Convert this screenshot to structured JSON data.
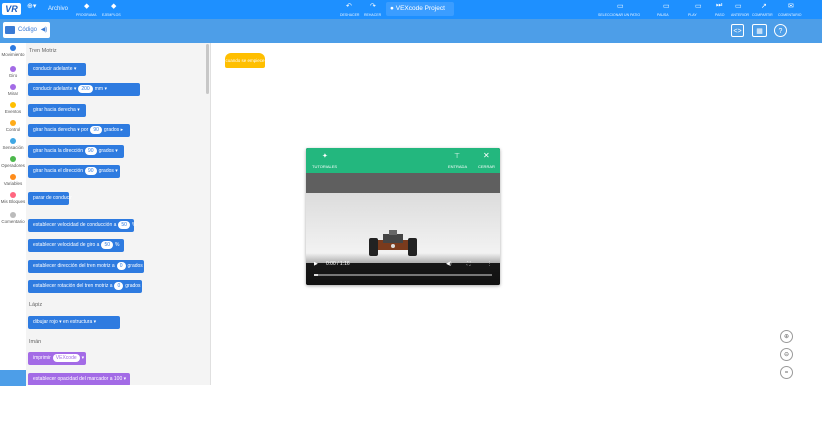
{
  "topbar": {
    "logo": "VR",
    "archive_label": "Archivo",
    "item_a": "PROGRAMA",
    "item_b": "EJEMPLOS",
    "undo_label": "DESHACER",
    "redo_label": "REHACER",
    "project_title": "VEXcode Project",
    "right_items": [
      "SELECCIONAR UN PATIO",
      "PAUSA",
      "PLAY",
      "PASO",
      "ANTERIOR",
      "COMPARTIR",
      "COMENTARIO"
    ]
  },
  "subbar": {
    "code_tab": "Código"
  },
  "categories": [
    {
      "label": "Movimiento",
      "color": "#2e7be0"
    },
    {
      "label": "Giro",
      "color": "#a36be6"
    },
    {
      "label": "Mirar",
      "color": "#a36be6"
    },
    {
      "label": "Eventos",
      "color": "#ffbf00"
    },
    {
      "label": "Control",
      "color": "#ffab19"
    },
    {
      "label": "Sensación",
      "color": "#3fa7e3"
    },
    {
      "label": "Operadores",
      "color": "#4cb84c"
    },
    {
      "label": "Variables",
      "color": "#ff8c1a"
    },
    {
      "label": "Mis Bloques",
      "color": "#ff6680"
    },
    {
      "label": "Comentario",
      "color": "#bbbbbb"
    }
  ],
  "flyout": {
    "section_motion": "Tren Motriz",
    "blocks": [
      {
        "text": "conducir",
        "pill": "adelante ▾"
      },
      {
        "text": "conducir adelante ▾",
        "pill": "200",
        "tail": "mm ▾"
      },
      {
        "text": "girar hacia",
        "pill": "derecha ▾"
      },
      {
        "text": "girar hacia derecha ▾ por",
        "pill": "90",
        "tail": "grados ▸"
      },
      {
        "text": "girar hacia la dirección",
        "pill": "90",
        "tail": "grados ▾"
      },
      {
        "text": "girar hacia el dirección",
        "pill": "90",
        "tail": "grados ▾"
      },
      {
        "text": "parar de conducir",
        "pill": "",
        "tail": ""
      },
      {
        "text": "establecer velocidad de conducción a",
        "pill": "50",
        "tail": "%"
      },
      {
        "text": "establecer velocidad de giro a",
        "pill": "50",
        "tail": "%"
      },
      {
        "text": "establecer dirección del tren motriz a",
        "pill": "0",
        "tail": "grados"
      },
      {
        "text": "establecer rotación del tren motriz a",
        "pill": "0",
        "tail": "grados"
      }
    ],
    "section_pen": "Lápiz",
    "pen_block": {
      "text": "dibujar",
      "pill": "rojo ▾",
      "tail": "en estructura ▾"
    },
    "section_magnet": "Imán",
    "magnet_blocks": [
      {
        "text": "imprimir",
        "pill": "VEXcode"
      },
      {
        "text": "establecer opacidad del marcador a",
        "pill": "",
        "tail": "100 ▾"
      }
    ]
  },
  "workspace": {
    "start_block": "cuando se empiece"
  },
  "video": {
    "left_label": "TUTORIALES",
    "mid_label": "ENTRADA",
    "right_label": "CERRAR",
    "time": "0:00 / 1:16",
    "progress": 0.02
  },
  "zoom": [
    "zoom-in",
    "zoom-out",
    "reset"
  ]
}
